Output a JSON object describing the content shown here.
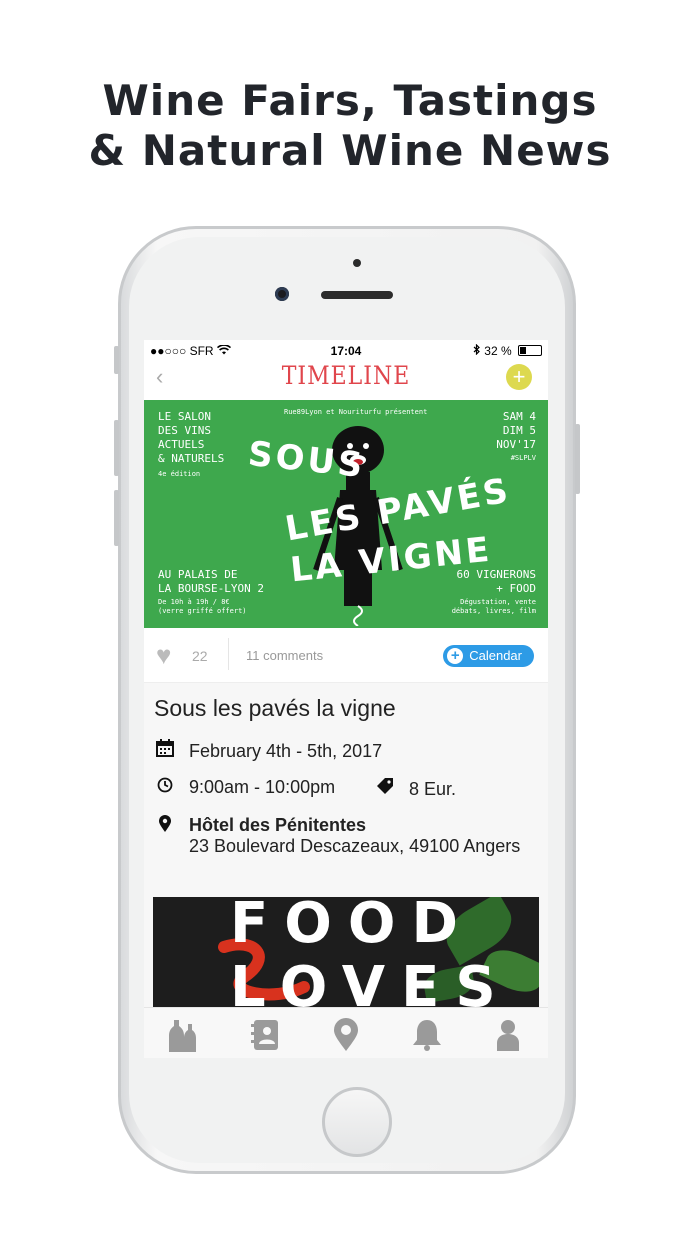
{
  "headline": {
    "line1": "Wine Fairs, Tastings",
    "line2": "& Natural Wine News"
  },
  "status_bar": {
    "carrier": "●●○○○ SFR",
    "time": "17:04",
    "battery": "32 %"
  },
  "navbar": {
    "back_icon": "chevron-left-icon",
    "logo_text": "TIMELINE",
    "add_label": "+"
  },
  "poster": {
    "header_left": [
      "LE SALON",
      "DES VINS",
      "ACTUELS",
      "& NATURELS"
    ],
    "edition": "4e édition",
    "presenters": "Rue89Lyon et Nouriturfu présentent",
    "dates": [
      "SAM 4",
      "DIM 5",
      "NOV'17"
    ],
    "hashtag": "#SLPLV",
    "title_lines": [
      "SOUS",
      "LES PAVÉS",
      "LA VIGNE"
    ],
    "venue": [
      "AU PALAIS DE",
      "LA BOURSE-LYON 2"
    ],
    "hours": [
      "De 10h à 19h / 8€",
      "(verre griffé offert)"
    ],
    "vignerons": [
      "60 VIGNERONS",
      "+ FOOD"
    ],
    "activities": [
      "Dégustation, vente",
      "débats, livres, film"
    ],
    "background_color": "#3ea84d"
  },
  "actions": {
    "likes": "22",
    "comments": "11 comments",
    "calendar_label": "Calendar"
  },
  "event": {
    "title": "Sous les pavés la vigne",
    "date": "February 4th - 5th, 2017",
    "time": "9:00am - 10:00pm",
    "price": "8 Eur.",
    "venue_name": "Hôtel des Pénitentes",
    "address": "23 Boulevard Descazeaux, 49100 Angers"
  },
  "next_card": {
    "line1": "FOOD",
    "line2": "LOVES"
  },
  "tabbar": {
    "items": [
      {
        "icon": "wine-bottles-icon"
      },
      {
        "icon": "address-book-icon"
      },
      {
        "icon": "map-pin-icon"
      },
      {
        "icon": "bell-icon"
      },
      {
        "icon": "user-icon"
      }
    ]
  },
  "colors": {
    "accent_red": "#e0464c",
    "calendar_blue": "#2d9be6",
    "add_yellow": "#ddd94f"
  }
}
